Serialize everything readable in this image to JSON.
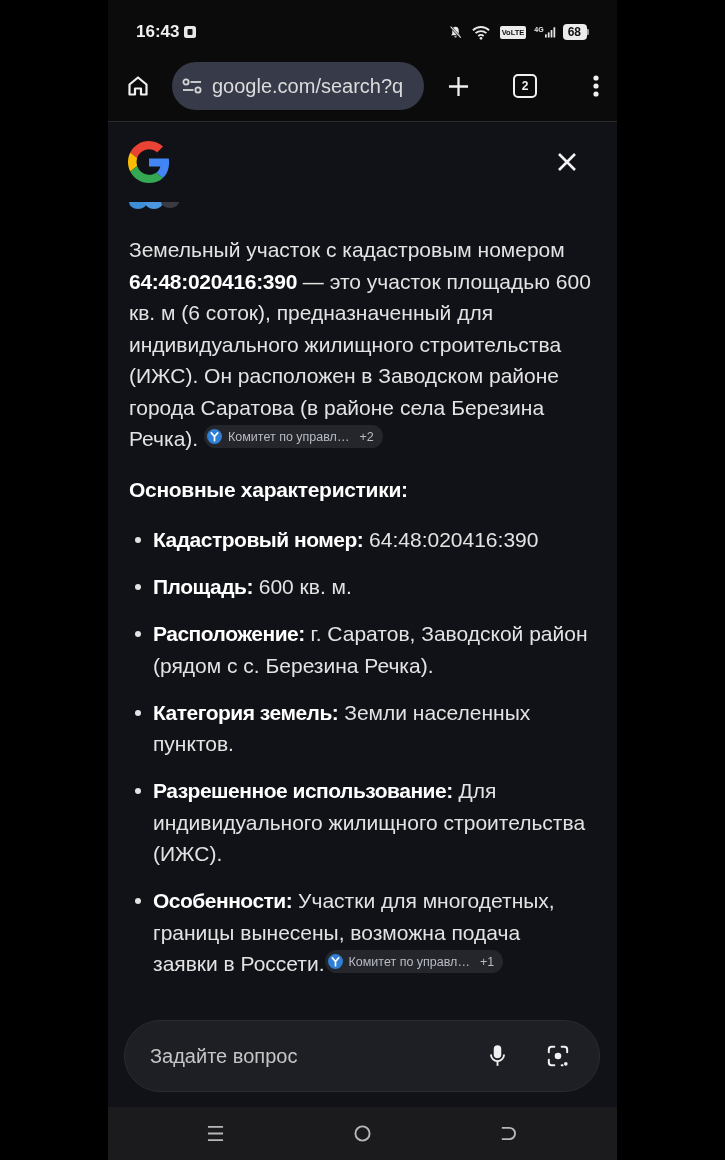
{
  "status_bar": {
    "time": "16:43",
    "volte": "VoLTE",
    "network": "4G",
    "battery": "68"
  },
  "toolbar": {
    "url": "google.com/search?q",
    "tab_count": "2"
  },
  "answer": {
    "paragraph": "Земельный участок с кадастровым номером **64:48:020416:390** — это участок площадью 600 кв. м (6 соток), предназначенный для индивидуального жилищного строительства (ИЖС). Он расположен в Заводском районе города Саратова (в районе села Березина Речка).",
    "paragraph_source": {
      "label": "Комитет по управл…",
      "count": "+2"
    },
    "heading": "Основные характеристики:",
    "items": [
      {
        "text": "**Кадастровый номер:** 64:48:020416:390"
      },
      {
        "text": "**Площадь:** 600 кв. м."
      },
      {
        "text": "**Расположение:** г. Саратов, Заводской район (рядом с с. Березина Речка)."
      },
      {
        "text": "**Категория земель:** Земли населенных пунктов."
      },
      {
        "text": "**Разрешенное использование:** Для индивидуального жилищного строительства (ИЖС)."
      },
      {
        "text": "**Особенности:** Участки для многодетных, границы вынесены, возможна подача заявки в Россети.",
        "source": {
          "label": "Комитет по управл…",
          "count": "+1"
        }
      }
    ]
  },
  "ask_field": {
    "placeholder": "Задайте вопрос"
  }
}
